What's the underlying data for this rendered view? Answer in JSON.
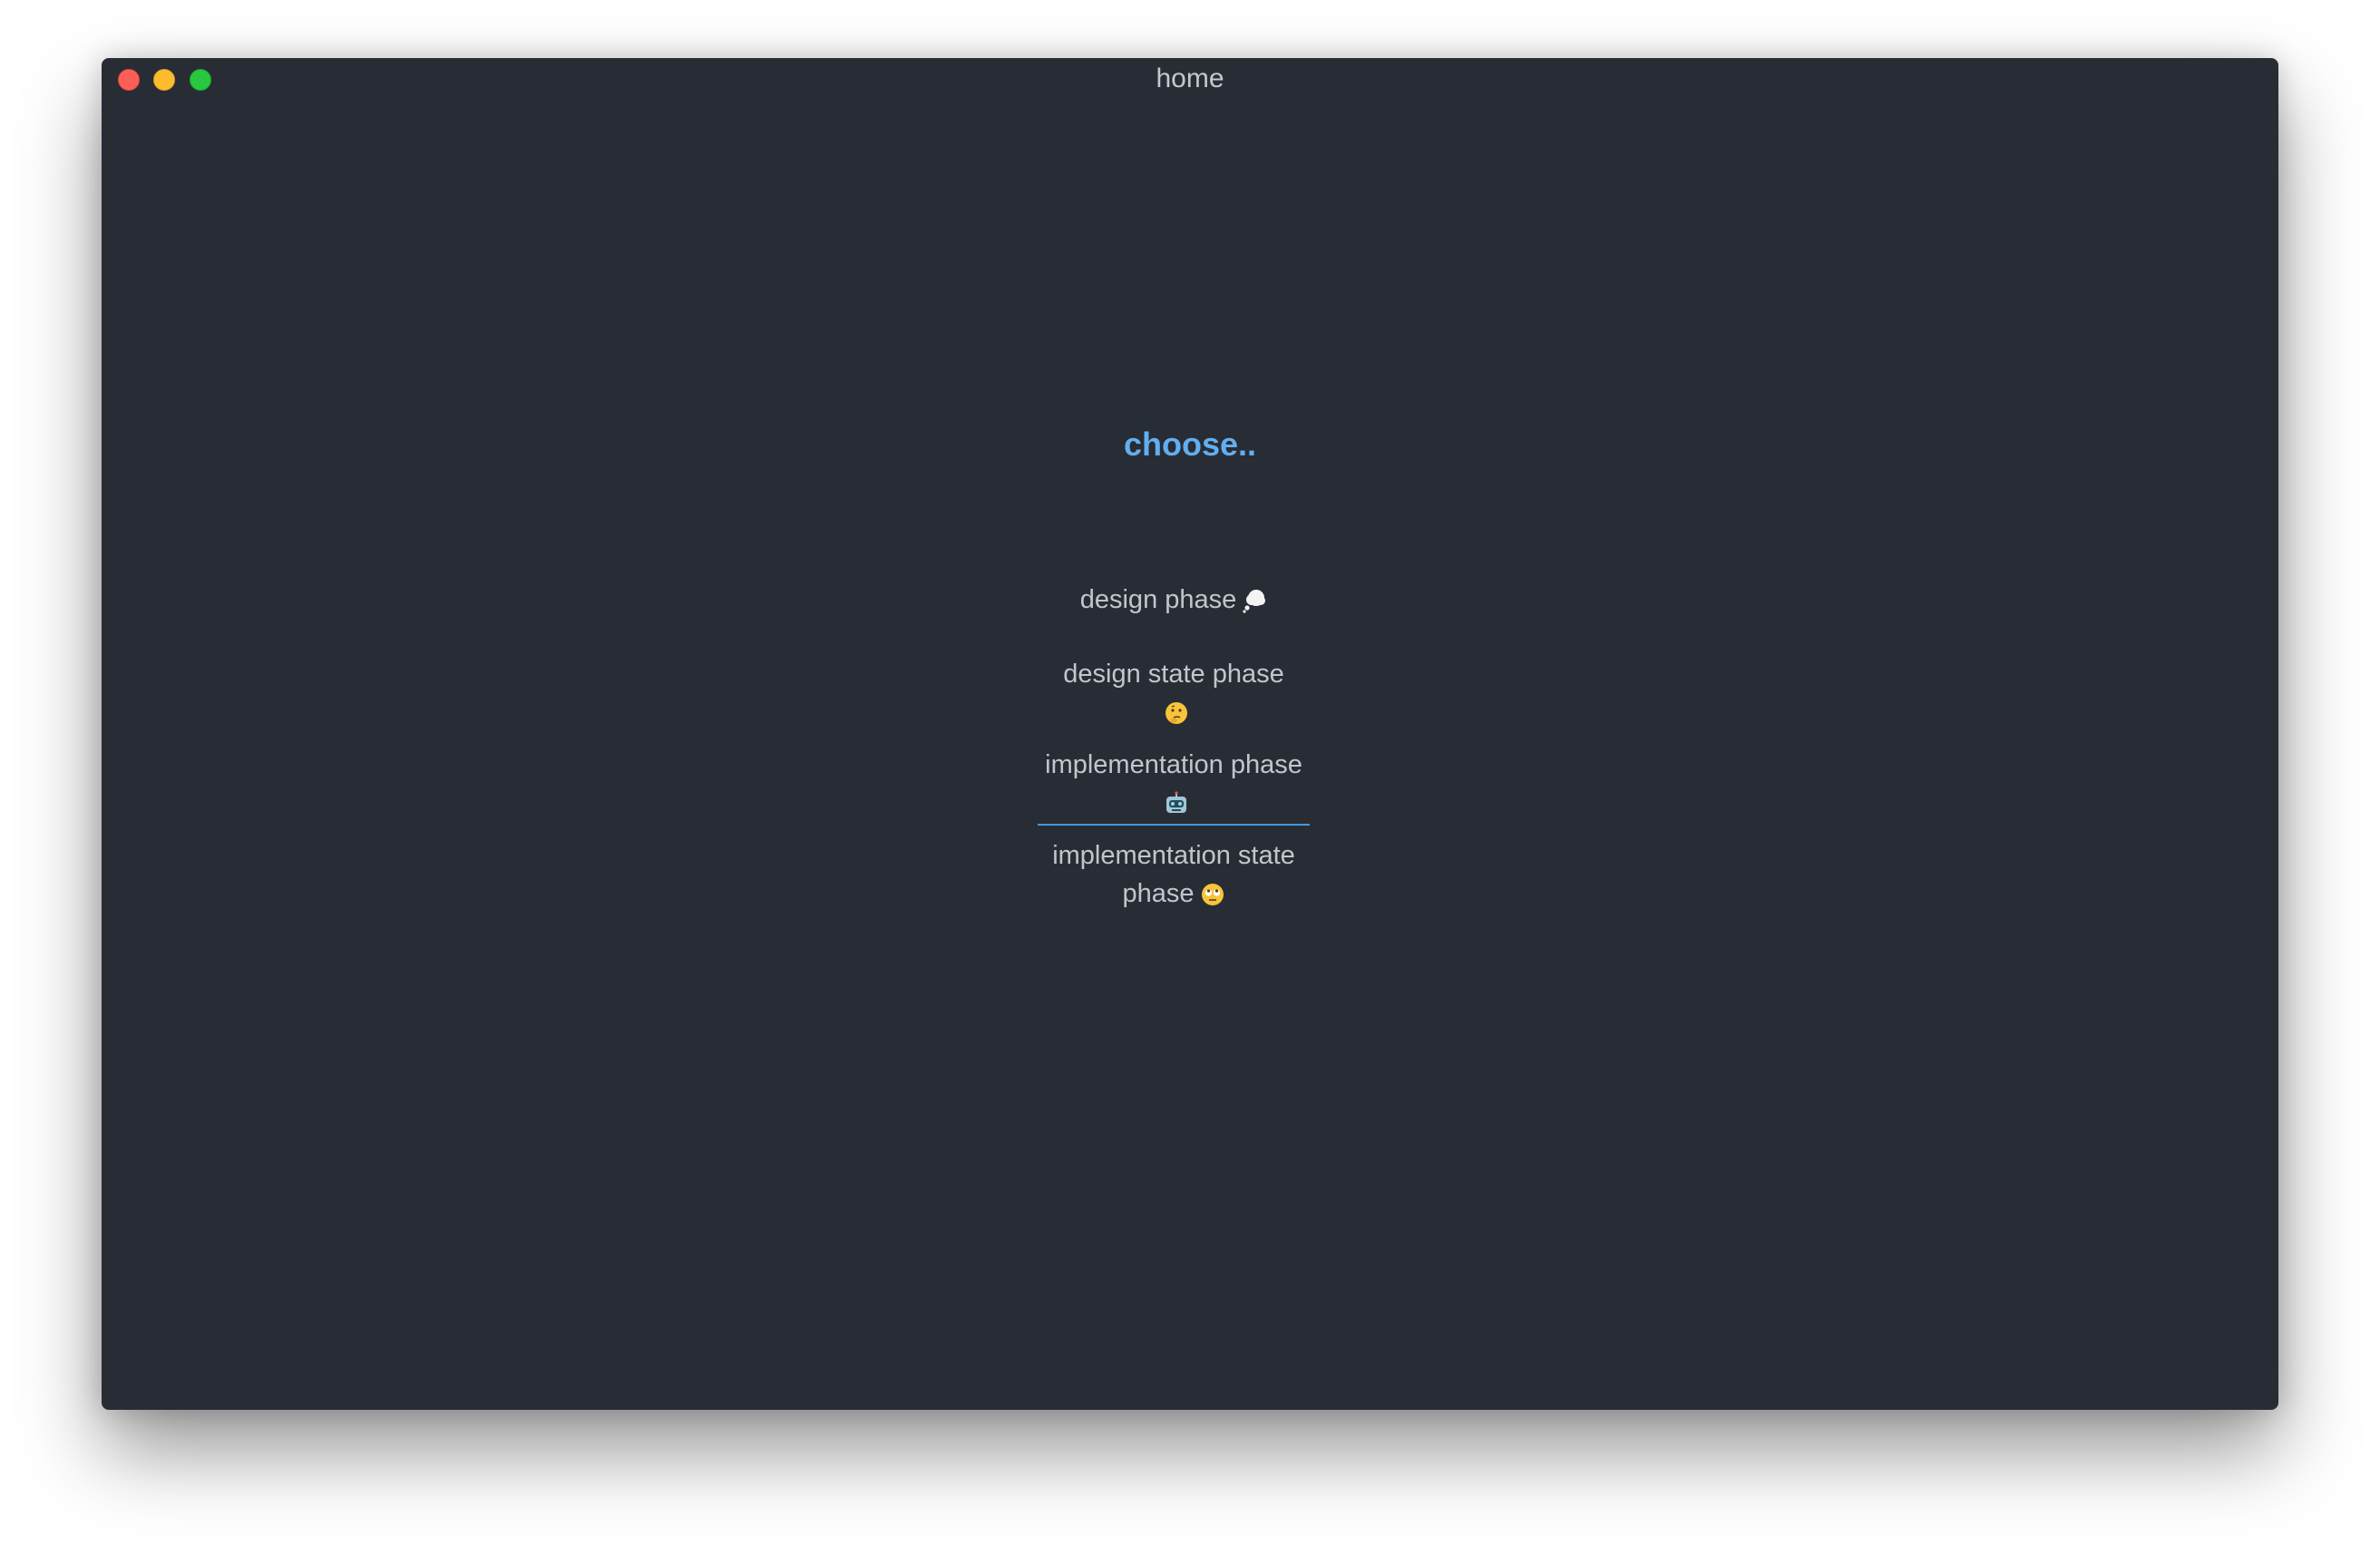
{
  "window": {
    "title": "home"
  },
  "main": {
    "heading": "choose..",
    "items": [
      {
        "label": "design phase",
        "icon": "thought-balloon-icon"
      },
      {
        "label": "design state phase",
        "icon": "thinking-face-icon"
      },
      {
        "label": "implementation phase",
        "icon": "robot-face-icon",
        "active": true
      },
      {
        "label": "implementation state phase",
        "icon": "rolling-eyes-face-icon"
      }
    ]
  },
  "colors": {
    "background": "#282c35",
    "accent": "#61aff0",
    "text": "#c2c6cc",
    "underline": "#4a97d6"
  }
}
